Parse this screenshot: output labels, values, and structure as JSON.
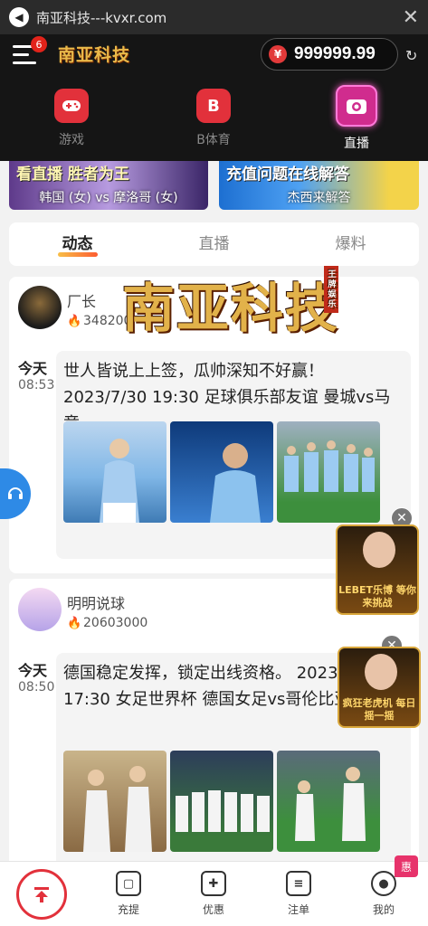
{
  "browser": {
    "title": "南亚科技---kvxr.com",
    "close_icon": "close-icon"
  },
  "header": {
    "notification_count": "6",
    "logo_text": "南亚科技",
    "currency_symbol": "¥",
    "balance": "999999.99"
  },
  "nav_tabs": [
    {
      "label": "游戏",
      "icon": "gamepad-icon",
      "color": "#e2313b"
    },
    {
      "label": "B体育",
      "icon": "b-sports-icon",
      "color": "#e2313b"
    },
    {
      "label": "直播",
      "icon": "camera-icon",
      "color": "#d02c8e",
      "active": true
    }
  ],
  "banners": [
    {
      "headline": "看直播 胜者为王",
      "caption": "韩国 (女) vs 摩洛哥 (女)"
    },
    {
      "headline": "充值问题在线解答",
      "caption": "杰西来解答"
    }
  ],
  "content_tabs": [
    "动态",
    "直播",
    "爆料"
  ],
  "watermark": {
    "text": "南亚科技",
    "seal": "王牌娱乐"
  },
  "posts": [
    {
      "author": "厂长",
      "views": "348200",
      "date_label": "今天",
      "time": "08:53",
      "text": "世人皆说上上签，瓜帅深知不好赢！ 2023/7/30 19:30 足球俱乐部友谊 曼城vs马竞"
    },
    {
      "author": "明明说球",
      "views": "20603000",
      "date_label": "今天",
      "time": "08:50",
      "text": "德国稳定发挥，锁定出线资格。 2023/7/30 17:30 女足世界杯 德国女足vs哥伦比亚女足"
    }
  ],
  "float_ads": [
    {
      "text": "LEBET乐博 等你来挑战"
    },
    {
      "text": "疯狂老虎机 每日摇一摇"
    }
  ],
  "bottom_nav": [
    {
      "label": "充提",
      "icon": "wallet-icon"
    },
    {
      "label": "优惠",
      "icon": "gift-icon"
    },
    {
      "label": "注单",
      "icon": "list-icon"
    },
    {
      "label": "我的",
      "icon": "user-icon"
    }
  ],
  "promo_badge": "惠",
  "colors": {
    "accent": "#e2313b",
    "dark_header": "#151515",
    "gold": "#e2b24a"
  }
}
